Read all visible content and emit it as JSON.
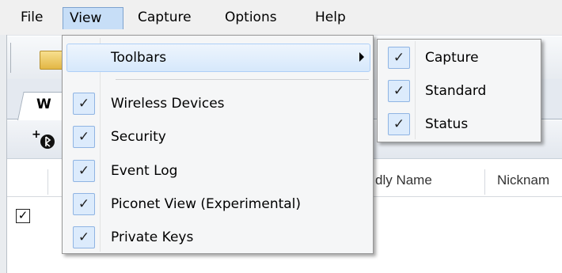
{
  "menubar": {
    "items": [
      "File",
      "View",
      "Capture",
      "Options",
      "Help"
    ],
    "active_index": 1
  },
  "background": {
    "tab_label": "W",
    "columns": [
      "dly Name",
      "Nicknam"
    ],
    "row_checked": true
  },
  "view_menu": {
    "toolbars_label": "Toolbars",
    "items": [
      {
        "label": "Wireless Devices",
        "checked": true
      },
      {
        "label": "Security",
        "checked": true
      },
      {
        "label": "Event Log",
        "checked": true
      },
      {
        "label": "Piconet View (Experimental)",
        "checked": true
      },
      {
        "label": "Private Keys",
        "checked": true
      }
    ]
  },
  "toolbars_submenu": {
    "items": [
      {
        "label": "Capture",
        "checked": true
      },
      {
        "label": "Standard",
        "checked": true
      },
      {
        "label": "Status",
        "checked": true
      }
    ]
  },
  "check_glyph": "✓",
  "colors": {
    "highlight": "#d6e8fb",
    "check_box": "#dcebfc",
    "menubar_active": "#c7def7"
  }
}
